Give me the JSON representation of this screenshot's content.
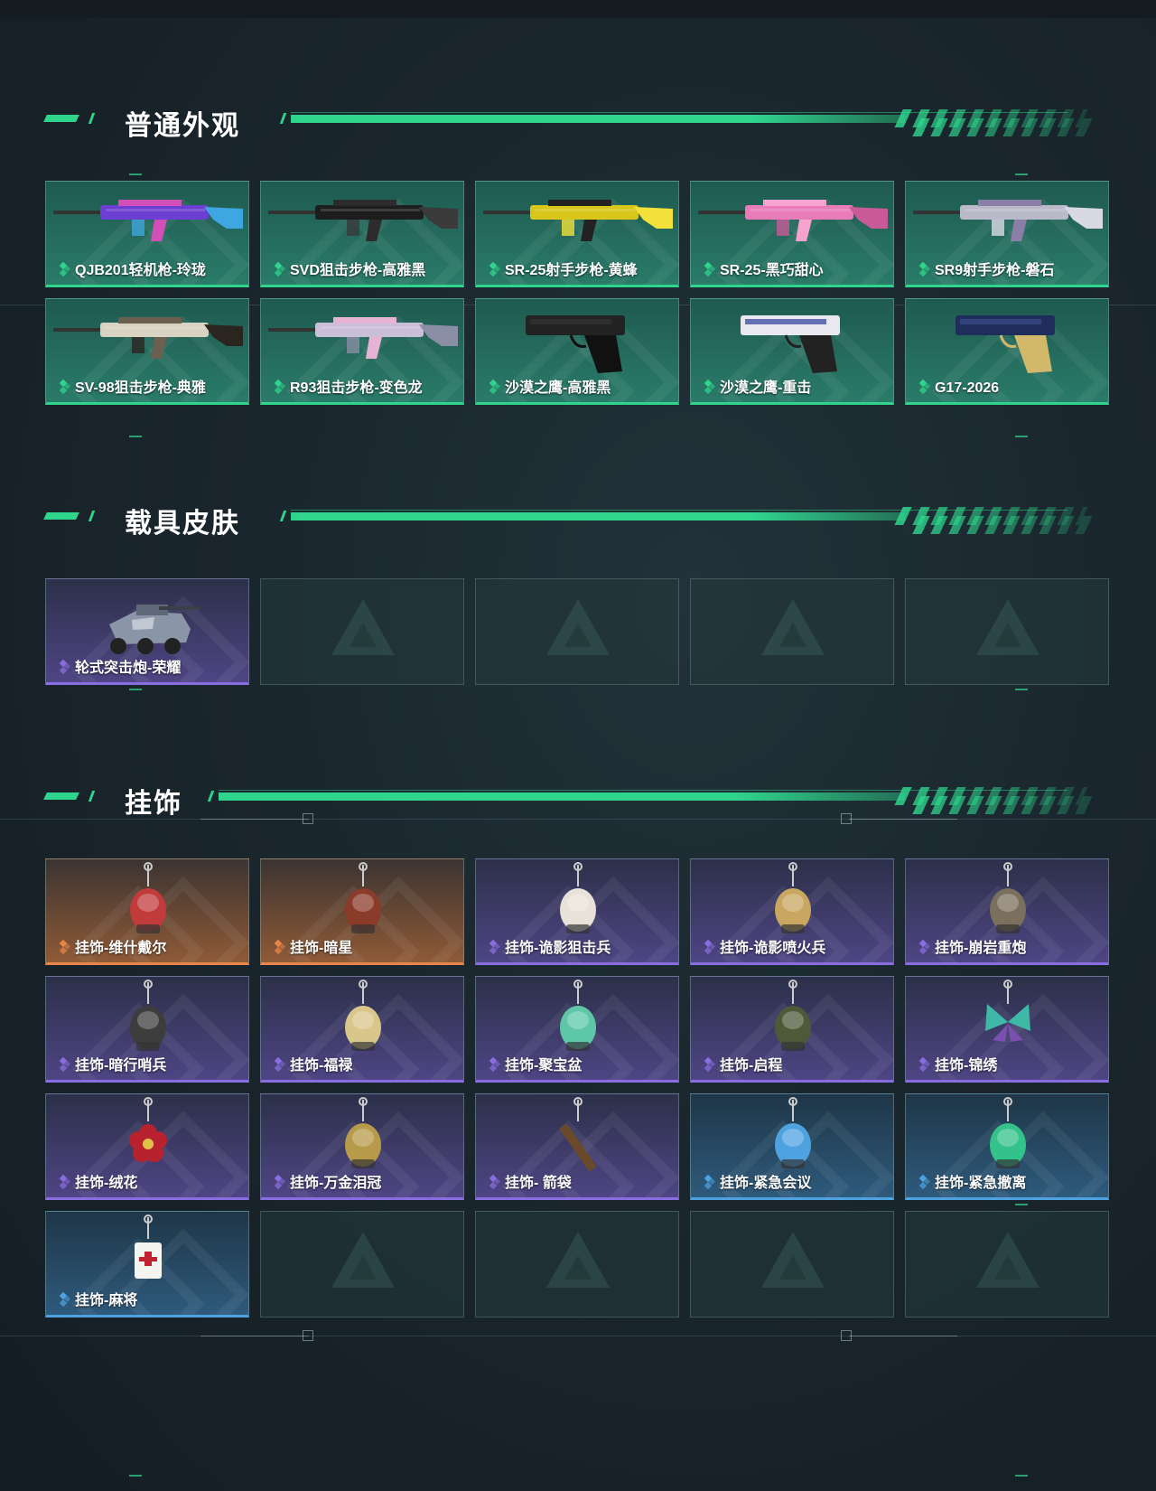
{
  "sections": [
    {
      "title": "普通外观",
      "items": [
        {
          "label": "QJB201轻机枪-玲珑",
          "rarity": "green",
          "icon": "light-machine-gun-icon"
        },
        {
          "label": "SVD狙击步枪-高雅黑",
          "rarity": "green",
          "icon": "sniper-rifle-icon"
        },
        {
          "label": "SR-25射手步枪-黄蜂",
          "rarity": "green",
          "icon": "marksman-rifle-icon"
        },
        {
          "label": "SR-25-黑巧甜心",
          "rarity": "green",
          "icon": "rifle-icon"
        },
        {
          "label": "SR9射手步枪-磐石",
          "rarity": "green",
          "icon": "marksman-rifle-icon"
        },
        {
          "label": "SV-98狙击步枪-典雅",
          "rarity": "green",
          "icon": "sniper-rifle-icon"
        },
        {
          "label": "R93狙击步枪-变色龙",
          "rarity": "green",
          "icon": "sniper-rifle-icon"
        },
        {
          "label": "沙漠之鹰-高雅黑",
          "rarity": "green",
          "icon": "pistol-icon"
        },
        {
          "label": "沙漠之鹰-重击",
          "rarity": "green",
          "icon": "pistol-icon"
        },
        {
          "label": "G17-2026",
          "rarity": "green",
          "icon": "pistol-icon"
        }
      ]
    },
    {
      "title": "载具皮肤",
      "items": [
        {
          "label": "轮式突击炮-荣耀",
          "rarity": "purple",
          "icon": "armored-vehicle-icon"
        }
      ]
    },
    {
      "title": "挂饰",
      "items": [
        {
          "label": "挂饰-维什戴尔",
          "rarity": "orange",
          "icon": "charm-icon"
        },
        {
          "label": "挂饰-暗星",
          "rarity": "orange",
          "icon": "charm-icon"
        },
        {
          "label": "挂饰-诡影狙击兵",
          "rarity": "purple",
          "icon": "charm-icon"
        },
        {
          "label": "挂饰-诡影喷火兵",
          "rarity": "purple",
          "icon": "charm-icon"
        },
        {
          "label": "挂饰-崩岩重炮",
          "rarity": "purple",
          "icon": "charm-icon"
        },
        {
          "label": "挂饰-暗行哨兵",
          "rarity": "purple",
          "icon": "charm-icon"
        },
        {
          "label": "挂饰-福禄",
          "rarity": "purple",
          "icon": "charm-icon"
        },
        {
          "label": "挂饰-聚宝盆",
          "rarity": "purple",
          "icon": "charm-icon"
        },
        {
          "label": "挂饰-启程",
          "rarity": "purple",
          "icon": "charm-icon"
        },
        {
          "label": "挂饰-锦绣",
          "rarity": "purple",
          "icon": "butterfly-charm-icon"
        },
        {
          "label": "挂饰-绒花",
          "rarity": "purple",
          "icon": "flower-charm-icon"
        },
        {
          "label": "挂饰-万金泪冠",
          "rarity": "purple",
          "icon": "charm-icon"
        },
        {
          "label": "挂饰- 箭袋",
          "rarity": "purple",
          "icon": "quiver-charm-icon"
        },
        {
          "label": "挂饰-紧急会议",
          "rarity": "blue",
          "icon": "charm-icon"
        },
        {
          "label": "挂饰-紧急撤离",
          "rarity": "blue",
          "icon": "charm-icon"
        },
        {
          "label": "挂饰-麻将",
          "rarity": "blue",
          "icon": "mahjong-charm-icon"
        }
      ]
    }
  ],
  "colors": {
    "accent": "#2fd58d",
    "green": "#2fd58d",
    "purple": "#8a6de0",
    "orange": "#e8864a",
    "blue": "#4ea2e0"
  }
}
